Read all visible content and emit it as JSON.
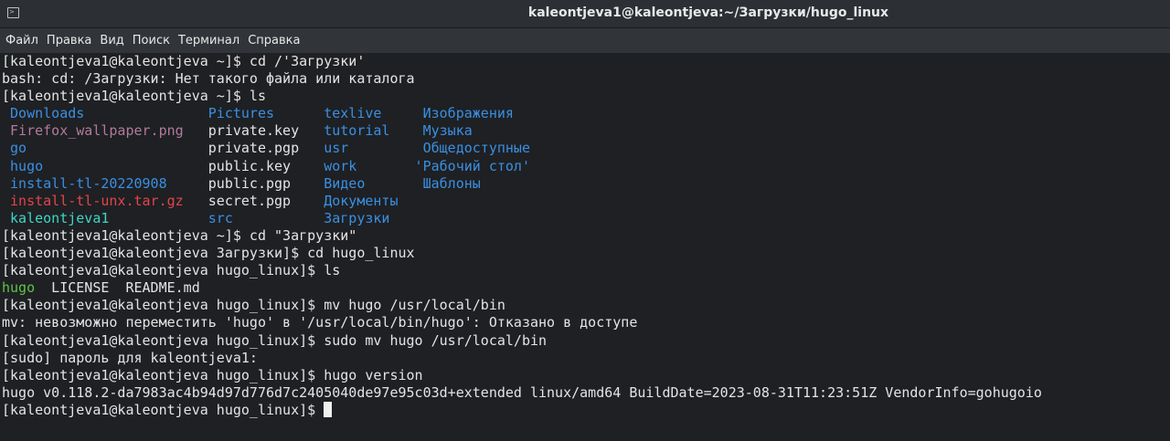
{
  "window": {
    "title": "kaleontjeva1@kaleontjeva:~/Загрузки/hugo_linux",
    "icon": "terminal-icon"
  },
  "menu": [
    "Файл",
    "Правка",
    "Вид",
    "Поиск",
    "Терминал",
    "Справка"
  ],
  "colors": {
    "default": "#e4e4e4",
    "dir": "#3b8fe3",
    "image": "#b27a9c",
    "archive": "#e0454b",
    "link": "#3dd6c6",
    "exec": "#5ec445"
  },
  "terminal": {
    "lines": [
      [
        {
          "t": "[kaleontjeva1@kaleontjeva ~]$ cd /'Загрузки'"
        }
      ],
      [
        {
          "t": "bash: cd: /Загрузки: Нет такого файла или каталога"
        }
      ],
      [
        {
          "t": "[kaleontjeva1@kaleontjeva ~]$ ls"
        }
      ],
      [
        {
          "t": " "
        },
        {
          "t": "Downloads",
          "c": "dir"
        },
        {
          "t": "               "
        },
        {
          "t": "Pictures",
          "c": "dir"
        },
        {
          "t": "      "
        },
        {
          "t": "texlive",
          "c": "dir"
        },
        {
          "t": "     "
        },
        {
          "t": "Изображения",
          "c": "dir"
        }
      ],
      [
        {
          "t": " "
        },
        {
          "t": "Firefox_wallpaper.png",
          "c": "image"
        },
        {
          "t": "   private.key   "
        },
        {
          "t": "tutorial",
          "c": "dir"
        },
        {
          "t": "    "
        },
        {
          "t": "Музыка",
          "c": "dir"
        }
      ],
      [
        {
          "t": " "
        },
        {
          "t": "go",
          "c": "dir"
        },
        {
          "t": "                      private.pgp   "
        },
        {
          "t": "usr",
          "c": "dir"
        },
        {
          "t": "         "
        },
        {
          "t": "Общедоступные",
          "c": "dir"
        }
      ],
      [
        {
          "t": " "
        },
        {
          "t": "hugo",
          "c": "dir"
        },
        {
          "t": "                    public.key    "
        },
        {
          "t": "work",
          "c": "dir"
        },
        {
          "t": "       "
        },
        {
          "t": "'Рабочий стол'",
          "c": "dir"
        }
      ],
      [
        {
          "t": " "
        },
        {
          "t": "install-tl-20220908",
          "c": "dir"
        },
        {
          "t": "     public.pgp    "
        },
        {
          "t": "Видео",
          "c": "dir"
        },
        {
          "t": "       "
        },
        {
          "t": "Шаблоны",
          "c": "dir"
        }
      ],
      [
        {
          "t": " "
        },
        {
          "t": "install-tl-unx.tar.gz",
          "c": "archive"
        },
        {
          "t": "   secret.pgp    "
        },
        {
          "t": "Документы",
          "c": "dir"
        }
      ],
      [
        {
          "t": " "
        },
        {
          "t": "kaleontjeva1",
          "c": "link"
        },
        {
          "t": "            "
        },
        {
          "t": "src",
          "c": "dir"
        },
        {
          "t": "           "
        },
        {
          "t": "Загрузки",
          "c": "dir"
        }
      ],
      [
        {
          "t": "[kaleontjeva1@kaleontjeva ~]$ cd \"Загрузки\""
        }
      ],
      [
        {
          "t": "[kaleontjeva1@kaleontjeva Загрузки]$ cd hugo_linux"
        }
      ],
      [
        {
          "t": "[kaleontjeva1@kaleontjeva hugo_linux]$ ls"
        }
      ],
      [
        {
          "t": "hugo",
          "c": "exec"
        },
        {
          "t": "  LICENSE  README.md"
        }
      ],
      [
        {
          "t": "[kaleontjeva1@kaleontjeva hugo_linux]$ mv hugo /usr/local/bin"
        }
      ],
      [
        {
          "t": "mv: невозможно переместить 'hugo' в '/usr/local/bin/hugo': Отказано в доступе"
        }
      ],
      [
        {
          "t": "[kaleontjeva1@kaleontjeva hugo_linux]$ sudo mv hugo /usr/local/bin"
        }
      ],
      [
        {
          "t": "[sudo] пароль для kaleontjeva1:"
        }
      ],
      [
        {
          "t": "[kaleontjeva1@kaleontjeva hugo_linux]$ hugo version"
        }
      ],
      [
        {
          "t": "hugo v0.118.2-da7983ac4b94d97d776d7c2405040de97e95c03d+extended linux/amd64 BuildDate=2023-08-31T11:23:51Z VendorInfo=gohugoio"
        }
      ],
      [
        {
          "t": "[kaleontjeva1@kaleontjeva hugo_linux]$ "
        }
      ]
    ]
  }
}
